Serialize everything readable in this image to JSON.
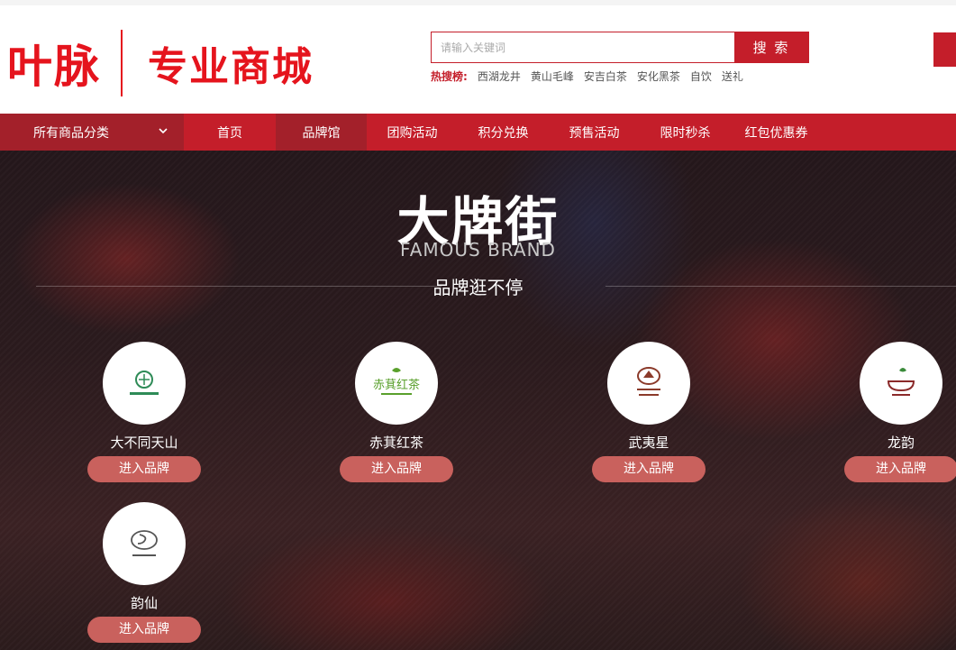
{
  "logo": {
    "main": "叶脉",
    "sub": "专业商城"
  },
  "search": {
    "placeholder": "请输入关键词",
    "button": "搜 索"
  },
  "hot": {
    "label": "热搜榜:",
    "items": [
      "西湖龙井",
      "黄山毛峰",
      "安吉白茶",
      "安化黑茶",
      "自饮",
      "送礼"
    ]
  },
  "nav": {
    "category": "所有商品分类",
    "items": [
      "首页",
      "品牌馆",
      "团购活动",
      "积分兑换",
      "预售活动",
      "限时秒杀",
      "红包优惠券"
    ],
    "active_index": 1
  },
  "hero": {
    "title": "大牌街",
    "subtitle_en": "FAMOUS BRAND",
    "tagline": "品牌逛不停"
  },
  "brands": [
    {
      "name": "大不同天山",
      "button": "进入品牌",
      "logo_color": "#2e8b57",
      "icon": "brand-logo-icon"
    },
    {
      "name": "赤萁红茶",
      "button": "进入品牌",
      "logo_color": "#5aa02c",
      "logo_text": "赤萁红茶",
      "icon": "brand-logo-icon"
    },
    {
      "name": "武夷星",
      "button": "进入品牌",
      "logo_color": "#8b3a2a",
      "icon": "brand-logo-icon"
    },
    {
      "name": "龙韵",
      "button": "进入品牌",
      "logo_color": "#8b2a2a",
      "icon": "brand-logo-icon"
    },
    {
      "name": "韵仙",
      "button": "进入品牌",
      "logo_color": "#555555",
      "icon": "brand-logo-icon"
    }
  ],
  "colors": {
    "brand_red": "#c41e2a",
    "nav_dark": "#a3202a",
    "button": "#c9615d"
  }
}
